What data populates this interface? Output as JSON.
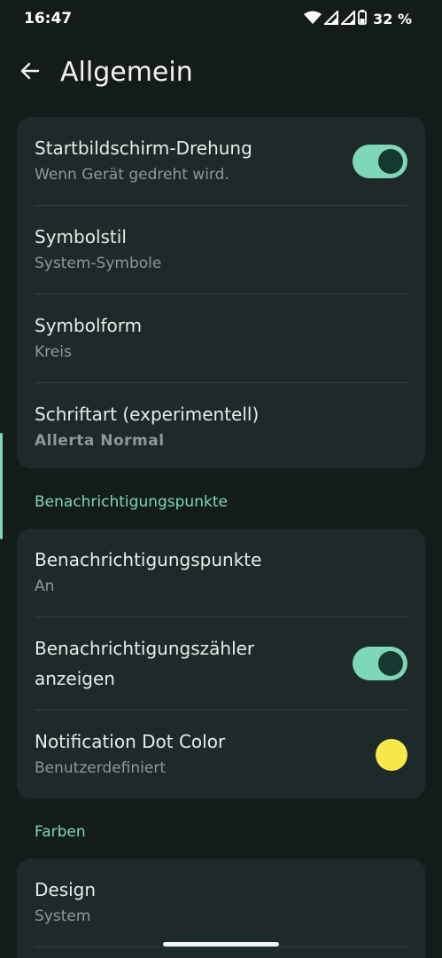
{
  "status_bar": {
    "time": "16:47",
    "battery": "32 %"
  },
  "header": {
    "title": "Allgemein"
  },
  "card_general": {
    "rows": [
      {
        "title": "Startbildschirm-Drehung",
        "subtitle": "Wenn Gerät gedreht wird.",
        "toggle_on": true
      },
      {
        "title": "Symbolstil",
        "subtitle": "System-Symbole"
      },
      {
        "title": "Symbolform",
        "subtitle": "Kreis"
      },
      {
        "title": "Schriftart (experimentell)",
        "subtitle": "Allerta Normal"
      }
    ]
  },
  "section_notification": {
    "header": "Benachrichtigungspunkte"
  },
  "card_notification": {
    "rows": [
      {
        "title": "Benachrichtigungspunkte",
        "subtitle": "An"
      },
      {
        "title_line1": "Benachrichtigungszähler",
        "title_line2": "anzeigen",
        "toggle_on": true
      },
      {
        "title": "Notification Dot Color",
        "subtitle": "Benutzerdefiniert",
        "dot_color": "#f8e84a"
      }
    ]
  },
  "section_colors": {
    "header": "Farben"
  },
  "card_colors": {
    "rows": [
      {
        "title": "Design",
        "subtitle": "System"
      }
    ]
  },
  "colors": {
    "accent": "#7ed7b6",
    "background": "#141c1b",
    "card": "#1e2a29"
  }
}
